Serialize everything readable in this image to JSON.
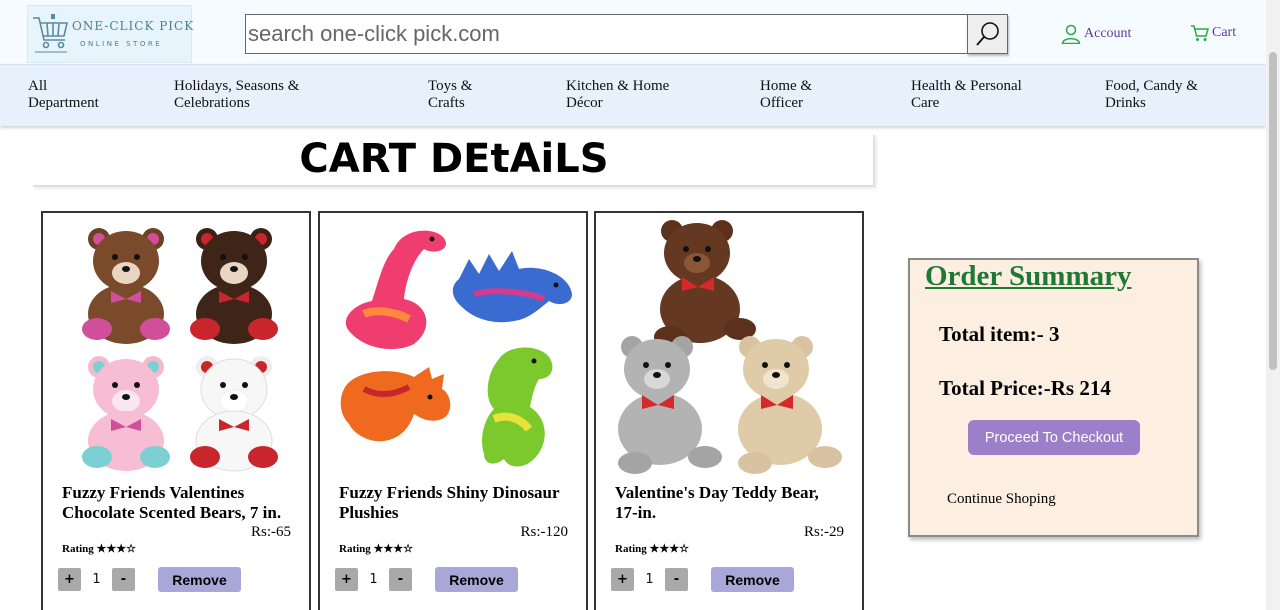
{
  "logo": {
    "title": "ONE-CLICK PICK",
    "subtitle": "ONLINE STORE"
  },
  "search": {
    "placeholder": "search one-click pick.com"
  },
  "header": {
    "account_label": "Account",
    "cart_label": "Cart"
  },
  "nav": [
    {
      "line1": "All",
      "line2": "Department"
    },
    {
      "line1": "Holidays, Seasons &",
      "line2": "Celebrations"
    },
    {
      "line1": "Toys &",
      "line2": "Crafts"
    },
    {
      "line1": "Kitchen & Home",
      "line2": "Décor"
    },
    {
      "line1": "Home &",
      "line2": "Officer"
    },
    {
      "line1": "Health & Personal",
      "line2": "Care"
    },
    {
      "line1": "Food, Candy &",
      "line2": "Drinks"
    }
  ],
  "page_title": "CART DEtAiLS",
  "products": [
    {
      "name": "Fuzzy Friends Valentines Chocolate Scented Bears, 7 in.",
      "price": "Rs:-65",
      "rating": "Rating ★★★☆",
      "qty": "1",
      "plus": "+",
      "minus": "-",
      "remove_label": "Remove"
    },
    {
      "name": "Fuzzy Friends Shiny Dinosaur Plushies",
      "price": "Rs:-120",
      "rating": "Rating ★★★☆",
      "qty": "1",
      "plus": "+",
      "minus": "-",
      "remove_label": "Remove"
    },
    {
      "name": "Valentine's Day Teddy Bear, 17-in.",
      "price": "Rs:-29",
      "rating": "Rating ★★★☆",
      "qty": "1",
      "plus": "+",
      "minus": "-",
      "remove_label": "Remove"
    }
  ],
  "summary": {
    "title": "Order Summary",
    "total_items": "Total item:- 3",
    "total_price": "Total Price:-Rs 214",
    "checkout_label": "Proceed To Checkout",
    "continue_label": "Continue Shoping"
  },
  "colors": {
    "accent": "#9b7fc9",
    "summary_title": "#1d7a35",
    "nav_bg": "#e6f1fc",
    "summary_bg": "#fcefe2"
  }
}
